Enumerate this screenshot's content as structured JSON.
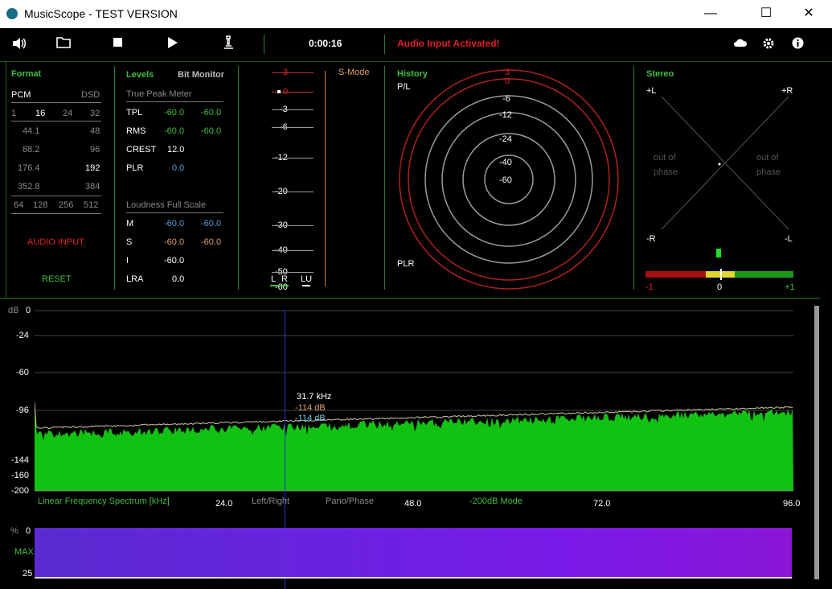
{
  "window": {
    "title": "MusicScope - TEST VERSION",
    "minimize": "—",
    "maximize": "☐",
    "close": "✕"
  },
  "toolbar": {
    "time": "0:00:16",
    "status": "Audio Input Activated!",
    "icons": [
      "speaker-icon",
      "folder-icon",
      "stop-icon",
      "play-icon",
      "microscope-icon",
      "cloud-icon",
      "gear-icon",
      "info-icon"
    ]
  },
  "format": {
    "title": "Format",
    "pcm": "PCM",
    "dsd": "DSD",
    "bits": [
      "1",
      "16",
      "24",
      "32"
    ],
    "rates": [
      [
        "44.1",
        "48"
      ],
      [
        "88.2",
        "96"
      ],
      [
        "176.4",
        "192"
      ],
      [
        "352.8",
        "384"
      ]
    ],
    "dsd_rates": [
      "64",
      "128",
      "256",
      "512"
    ],
    "audio_input": "AUDIO INPUT",
    "reset": "RESET"
  },
  "levels": {
    "title": "Levels",
    "bit_monitor": "Bit Monitor",
    "true_peak_title": "True Peak Meter",
    "tpl": {
      "label": "TPL",
      "l": "-60.0",
      "r": "-60.0"
    },
    "rms": {
      "label": "RMS",
      "l": "-60.0",
      "r": "-60.0"
    },
    "crest": {
      "label": "CREST",
      "v": "12.0"
    },
    "plr": {
      "label": "PLR",
      "v": "0.0"
    },
    "loudness_title": "Loudness Full Scale",
    "m": {
      "label": "M",
      "l": "-60.0",
      "r": "-60.0"
    },
    "s": {
      "label": "S",
      "l": "-60.0",
      "r": "-60.0"
    },
    "i": {
      "label": "I",
      "v": "-60.0"
    },
    "lra": {
      "label": "LRA",
      "v": "0.0"
    }
  },
  "meter": {
    "scale": [
      "3",
      "0",
      "-3",
      "-6",
      "-12",
      "-20",
      "-30",
      "-40",
      "-50",
      "-60"
    ],
    "channels": [
      "L",
      "R",
      "LU"
    ],
    "smode": "S-Mode"
  },
  "history": {
    "title": "History",
    "pl": "P/L",
    "plr": "PLR",
    "rings": [
      "3",
      "0",
      "-6",
      "-12",
      "-24",
      "-40",
      "-60"
    ]
  },
  "stereo": {
    "title": "Stereo",
    "pl": "+L",
    "pr": "+R",
    "ml": "-R",
    "mr": "-L",
    "oop_left": [
      "out of",
      "phase"
    ],
    "oop_right": [
      "out of",
      "phase"
    ],
    "corr_min": "-1",
    "corr_mid": "0",
    "corr_max": "+1"
  },
  "spectrum": {
    "unit": "dB",
    "y_ticks": [
      "0",
      "-24",
      "-60",
      "-96",
      "-144",
      "-160",
      "-200"
    ],
    "x_ticks": [
      "24.0",
      "48.0",
      "72.0",
      "96.0"
    ],
    "mode_label": "Linear Frequency Spectrum [kHz]",
    "left_right": "Left/Right",
    "pano_phase": "Pano/Phase",
    "db_mode": "-200dB Mode",
    "cursor": {
      "freq": "31.7 kHz",
      "l": "-114 dB",
      "r": "-114 dB"
    }
  },
  "spectrogram": {
    "unit": "%",
    "top": "0",
    "max": "MAX",
    "bottom": "25"
  },
  "colors": {
    "green": "#3fbf3f",
    "red": "#e02020",
    "accent_blue": "#5a9cd8"
  }
}
